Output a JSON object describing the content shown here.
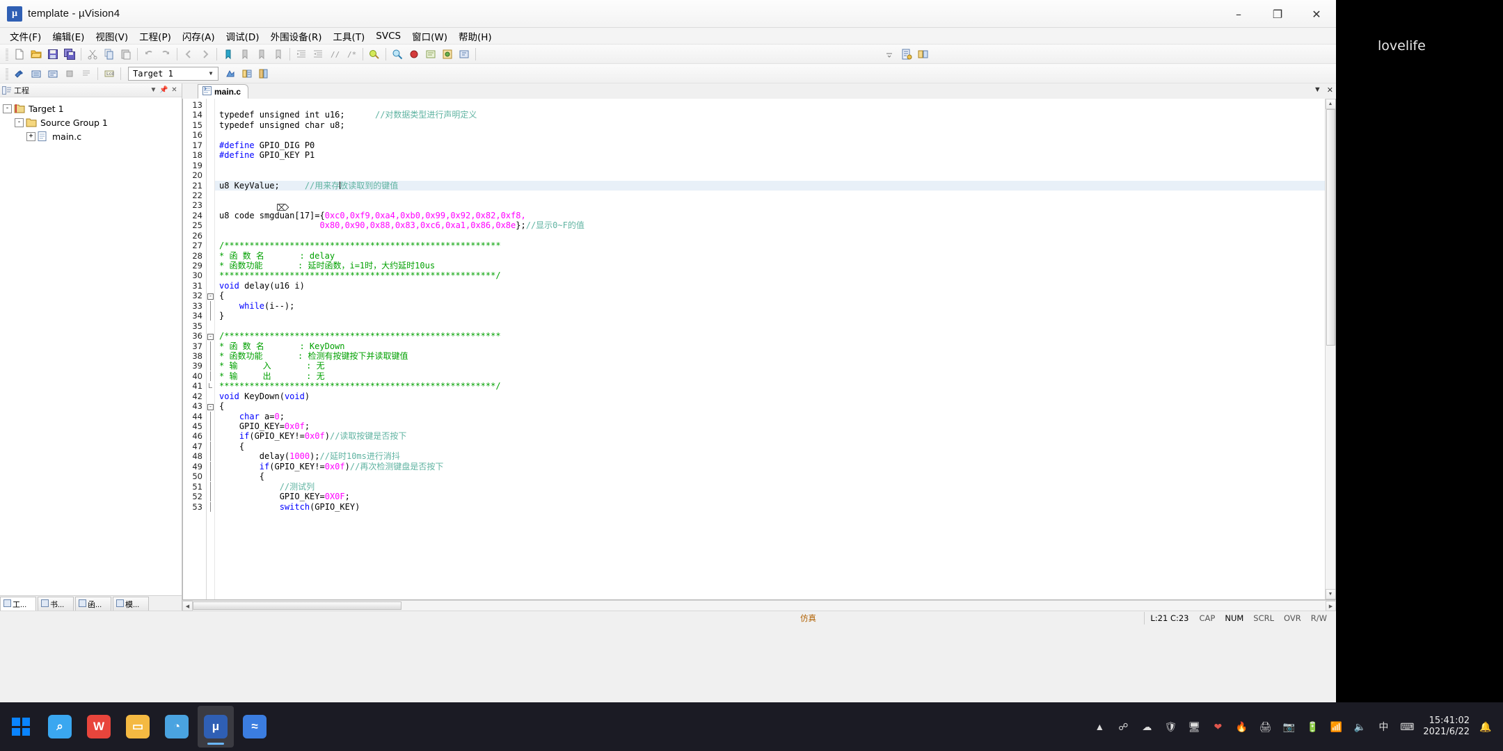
{
  "window": {
    "title": "template  - µVision4",
    "app_icon": "keil-uvision-icon",
    "minimize": "–",
    "maximize": "❐",
    "close": "✕"
  },
  "watermark": "lovelife",
  "menu": [
    {
      "label": "文件(F)",
      "name": "menu-file"
    },
    {
      "label": "编辑(E)",
      "name": "menu-edit"
    },
    {
      "label": "视图(V)",
      "name": "menu-view"
    },
    {
      "label": "工程(P)",
      "name": "menu-project"
    },
    {
      "label": "闪存(A)",
      "name": "menu-flash"
    },
    {
      "label": "调试(D)",
      "name": "menu-debug"
    },
    {
      "label": "外围设备(R)",
      "name": "menu-peripherals"
    },
    {
      "label": "工具(T)",
      "name": "menu-tools"
    },
    {
      "label": "SVCS",
      "name": "menu-svcs"
    },
    {
      "label": "窗口(W)",
      "name": "menu-window"
    },
    {
      "label": "帮助(H)",
      "name": "menu-help"
    }
  ],
  "toolbar_main": {
    "icons": [
      "new-file-icon",
      "open-folder-icon",
      "save-icon",
      "save-all-icon",
      "cut-icon",
      "copy-icon",
      "paste-icon",
      "undo-icon",
      "redo-icon",
      "navigate-back-icon",
      "navigate-forward-icon",
      "bookmark-toggle-icon",
      "bookmark-next-icon",
      "bookmark-prev-icon",
      "bookmark-clear-icon",
      "indent-icon",
      "outdent-icon",
      "comment-icon",
      "uncomment-icon",
      "debug-start-icon",
      "find-icon",
      "breakpoint-icon",
      "insert-bookmark-icon",
      "config-wizard-icon",
      "build-target-icon",
      "options-target-icon"
    ],
    "zoom_label": ""
  },
  "toolbar_build": {
    "icons": [
      "build-icon",
      "rebuild-icon",
      "batch-build-icon",
      "stop-build-icon",
      "download-icon",
      "lcd-icon"
    ],
    "target_value": "Target 1",
    "target_dropdown_icon": "chevron-down-icon",
    "after_icons": [
      "target-options-icon",
      "manage-components-icon",
      "book-icon"
    ]
  },
  "project_pane": {
    "title": "工程",
    "head_icon": "project-window-icon",
    "buttons": [
      "pin-icon",
      "minimize-icon",
      "close-icon"
    ],
    "tree": [
      {
        "label": "Target 1",
        "depth": 0,
        "expander": "-",
        "icon": "target-icon",
        "name": "tree-item-target-1"
      },
      {
        "label": "Source Group 1",
        "depth": 1,
        "expander": "-",
        "icon": "folder-icon",
        "name": "tree-item-source-group-1"
      },
      {
        "label": "main.c",
        "depth": 2,
        "expander": "+",
        "icon": "c-file-icon",
        "name": "tree-item-main-c"
      }
    ],
    "tabs": [
      {
        "label": "工...",
        "icon": "project-icon",
        "active": true,
        "name": "pane-tab-project"
      },
      {
        "label": "书...",
        "icon": "books-icon",
        "active": false,
        "name": "pane-tab-books"
      },
      {
        "label": "函...",
        "icon": "functions-icon",
        "active": false,
        "name": "pane-tab-functions"
      },
      {
        "label": "模...",
        "icon": "templates-icon",
        "active": false,
        "name": "pane-tab-templates"
      }
    ]
  },
  "editor": {
    "tab": {
      "label": "main.c",
      "icon": "c-file-icon"
    },
    "tabrow_buttons": [
      "chevron-down-icon",
      "close-icon"
    ],
    "first_line_number": 13,
    "cursor_line": 21,
    "lines": [
      {
        "n": 13,
        "fold": "",
        "hl": false,
        "tokens": []
      },
      {
        "n": 14,
        "fold": "",
        "hl": false,
        "tokens": [
          {
            "t": "typedef unsigned int u16;",
            "c": "plain"
          },
          {
            "t": "      ",
            "c": "plain"
          },
          {
            "t": "//对数据类型进行声明定义",
            "c": "cmt"
          }
        ]
      },
      {
        "n": 15,
        "fold": "",
        "hl": false,
        "tokens": [
          {
            "t": "typedef unsigned char u8;",
            "c": "plain"
          }
        ]
      },
      {
        "n": 16,
        "fold": "",
        "hl": false,
        "tokens": []
      },
      {
        "n": 17,
        "fold": "",
        "hl": false,
        "tokens": [
          {
            "t": "#define",
            "c": "pp"
          },
          {
            "t": " GPIO_DIG P0",
            "c": "plain"
          }
        ]
      },
      {
        "n": 18,
        "fold": "",
        "hl": false,
        "tokens": [
          {
            "t": "#define",
            "c": "pp"
          },
          {
            "t": " GPIO_KEY P1",
            "c": "plain"
          }
        ]
      },
      {
        "n": 19,
        "fold": "",
        "hl": false,
        "tokens": []
      },
      {
        "n": 20,
        "fold": "",
        "hl": false,
        "tokens": []
      },
      {
        "n": 21,
        "fold": "",
        "hl": true,
        "tokens": [
          {
            "t": "u8 KeyValue;",
            "c": "plain"
          },
          {
            "t": "     ",
            "c": "plain"
          },
          {
            "t": "//用来存放读取到的键值",
            "c": "cmt"
          }
        ]
      },
      {
        "n": 22,
        "fold": "",
        "hl": false,
        "tokens": []
      },
      {
        "n": 23,
        "fold": "",
        "hl": false,
        "tokens": []
      },
      {
        "n": 24,
        "fold": "",
        "hl": false,
        "tokens": [
          {
            "t": "u8 code smgduan[17]={",
            "c": "plain"
          },
          {
            "t": "0xc0,0xf9,0xa4,0xb0,0x99,0x92,0x82,0xf8,",
            "c": "num"
          }
        ]
      },
      {
        "n": 25,
        "fold": "",
        "hl": false,
        "tokens": [
          {
            "t": "                    ",
            "c": "plain"
          },
          {
            "t": "0x80,0x90,0x88,0x83,0xc6,0xa1,0x86,0x8e",
            "c": "num"
          },
          {
            "t": "};",
            "c": "plain"
          },
          {
            "t": "//显示0~F的值",
            "c": "cmt"
          }
        ]
      },
      {
        "n": 26,
        "fold": "",
        "hl": false,
        "tokens": []
      },
      {
        "n": 27,
        "fold": "",
        "hl": false,
        "tokens": [
          {
            "t": "/*******************************************************",
            "c": "green"
          }
        ]
      },
      {
        "n": 28,
        "fold": "",
        "hl": false,
        "tokens": [
          {
            "t": "* 函 数 名       : delay",
            "c": "green"
          }
        ]
      },
      {
        "n": 29,
        "fold": "",
        "hl": false,
        "tokens": [
          {
            "t": "* 函数功能       : 延时函数，i=1时，大约延时10us",
            "c": "green"
          }
        ]
      },
      {
        "n": 30,
        "fold": "",
        "hl": false,
        "tokens": [
          {
            "t": "*******************************************************/",
            "c": "green"
          }
        ]
      },
      {
        "n": 31,
        "fold": "",
        "hl": false,
        "tokens": [
          {
            "t": "void",
            "c": "kw"
          },
          {
            "t": " delay(u16 i)",
            "c": "plain"
          }
        ]
      },
      {
        "n": 32,
        "fold": "-",
        "hl": false,
        "tokens": [
          {
            "t": "{",
            "c": "plain"
          }
        ]
      },
      {
        "n": 33,
        "fold": "|",
        "hl": false,
        "tokens": [
          {
            "t": "    ",
            "c": "plain"
          },
          {
            "t": "while",
            "c": "kw"
          },
          {
            "t": "(i--);",
            "c": "plain"
          }
        ]
      },
      {
        "n": 34,
        "fold": "|",
        "hl": false,
        "tokens": [
          {
            "t": "}",
            "c": "plain"
          }
        ]
      },
      {
        "n": 35,
        "fold": "",
        "hl": false,
        "tokens": []
      },
      {
        "n": 36,
        "fold": "-",
        "hl": false,
        "tokens": [
          {
            "t": "/*******************************************************",
            "c": "green"
          }
        ]
      },
      {
        "n": 37,
        "fold": "|",
        "hl": false,
        "tokens": [
          {
            "t": "* 函 数 名       : KeyDown",
            "c": "green"
          }
        ]
      },
      {
        "n": 38,
        "fold": "|",
        "hl": false,
        "tokens": [
          {
            "t": "* 函数功能       : 检测有按键按下并读取键值",
            "c": "green"
          }
        ]
      },
      {
        "n": 39,
        "fold": "|",
        "hl": false,
        "tokens": [
          {
            "t": "* 输     入       : 无",
            "c": "green"
          }
        ]
      },
      {
        "n": 40,
        "fold": "|",
        "hl": false,
        "tokens": [
          {
            "t": "* 输     出       : 无",
            "c": "green"
          }
        ]
      },
      {
        "n": 41,
        "fold": "L",
        "hl": false,
        "tokens": [
          {
            "t": "*******************************************************/",
            "c": "green"
          }
        ]
      },
      {
        "n": 42,
        "fold": "",
        "hl": false,
        "tokens": [
          {
            "t": "void",
            "c": "kw"
          },
          {
            "t": " KeyDown(",
            "c": "plain"
          },
          {
            "t": "void",
            "c": "kw"
          },
          {
            "t": ")",
            "c": "plain"
          }
        ]
      },
      {
        "n": 43,
        "fold": "-",
        "hl": false,
        "tokens": [
          {
            "t": "{",
            "c": "plain"
          }
        ]
      },
      {
        "n": 44,
        "fold": "|",
        "hl": false,
        "tokens": [
          {
            "t": "    ",
            "c": "plain"
          },
          {
            "t": "char",
            "c": "kw"
          },
          {
            "t": " a=",
            "c": "plain"
          },
          {
            "t": "0",
            "c": "num"
          },
          {
            "t": ";",
            "c": "plain"
          }
        ]
      },
      {
        "n": 45,
        "fold": "|",
        "hl": false,
        "tokens": [
          {
            "t": "    GPIO_KEY=",
            "c": "plain"
          },
          {
            "t": "0x0f",
            "c": "num"
          },
          {
            "t": ";",
            "c": "plain"
          }
        ]
      },
      {
        "n": 46,
        "fold": "|",
        "hl": false,
        "tokens": [
          {
            "t": "    ",
            "c": "plain"
          },
          {
            "t": "if",
            "c": "kw"
          },
          {
            "t": "(GPIO_KEY!=",
            "c": "plain"
          },
          {
            "t": "0x0f",
            "c": "num"
          },
          {
            "t": ")",
            "c": "plain"
          },
          {
            "t": "//读取按键是否按下",
            "c": "cmt"
          }
        ]
      },
      {
        "n": 47,
        "fold": "|",
        "hl": false,
        "tokens": [
          {
            "t": "    {",
            "c": "plain"
          }
        ]
      },
      {
        "n": 48,
        "fold": "|",
        "hl": false,
        "tokens": [
          {
            "t": "        delay(",
            "c": "plain"
          },
          {
            "t": "1000",
            "c": "num"
          },
          {
            "t": ");",
            "c": "plain"
          },
          {
            "t": "//延时10ms进行消抖",
            "c": "cmt"
          }
        ]
      },
      {
        "n": 49,
        "fold": "|",
        "hl": false,
        "tokens": [
          {
            "t": "        ",
            "c": "plain"
          },
          {
            "t": "if",
            "c": "kw"
          },
          {
            "t": "(GPIO_KEY!=",
            "c": "plain"
          },
          {
            "t": "0x0f",
            "c": "num"
          },
          {
            "t": ")",
            "c": "plain"
          },
          {
            "t": "//再次检测键盘是否按下",
            "c": "cmt"
          }
        ]
      },
      {
        "n": 50,
        "fold": "|",
        "hl": false,
        "tokens": [
          {
            "t": "        {",
            "c": "plain"
          }
        ]
      },
      {
        "n": 51,
        "fold": "|",
        "hl": false,
        "tokens": [
          {
            "t": "            ",
            "c": "plain"
          },
          {
            "t": "//测试列",
            "c": "cmt"
          }
        ]
      },
      {
        "n": 52,
        "fold": "|",
        "hl": false,
        "tokens": [
          {
            "t": "            GPIO_KEY=",
            "c": "plain"
          },
          {
            "t": "0X0F",
            "c": "num"
          },
          {
            "t": ";",
            "c": "plain"
          }
        ]
      },
      {
        "n": 53,
        "fold": "|",
        "hl": false,
        "tokens": [
          {
            "t": "            ",
            "c": "plain"
          },
          {
            "t": "switch",
            "c": "kw"
          },
          {
            "t": "(GPIO_KEY)",
            "c": "plain"
          }
        ]
      }
    ]
  },
  "statusbar": {
    "simulation": "仿真",
    "position": "L:21 C:23",
    "flags": [
      {
        "label": "CAP",
        "on": false
      },
      {
        "label": "NUM",
        "on": true
      },
      {
        "label": "SCRL",
        "on": false
      },
      {
        "label": "OVR",
        "on": false
      },
      {
        "label": "R/W",
        "on": false
      }
    ]
  },
  "taskbar": {
    "start_icon": "windows-start-icon",
    "apps": [
      {
        "name": "taskbar-search",
        "icon": "search-icon",
        "letter": "⌕",
        "color": "#3aa7f0",
        "active": false
      },
      {
        "name": "taskbar-wps",
        "icon": "wps-icon",
        "letter": "W",
        "color": "#e8453c",
        "active": false
      },
      {
        "name": "taskbar-explorer",
        "icon": "file-explorer-icon",
        "letter": "▭",
        "color": "#f4b942",
        "active": false
      },
      {
        "name": "taskbar-qq",
        "icon": "qq-icon",
        "letter": "◔",
        "color": "#4aa3e0",
        "active": false
      },
      {
        "name": "taskbar-keil",
        "icon": "keil-uvision-icon",
        "letter": "μ",
        "color": "#2f5fb4",
        "active": true
      },
      {
        "name": "taskbar-editor",
        "icon": "editor-icon",
        "letter": "≈",
        "color": "#3b7de0",
        "active": false
      }
    ],
    "tray_icons": [
      "chevron-up-icon",
      "bluetooth-icon",
      "cloud-icon",
      "shield-icon",
      "monitor-icon",
      "heart-icon",
      "flame-icon",
      "printer-icon",
      "camera-icon",
      "battery-icon",
      "network-icon",
      "volume-icon",
      "keyboard-icon"
    ],
    "ime": "中",
    "notification_icon": "notification-bell-icon",
    "time": "15:41:02",
    "date": "2021/6/22"
  }
}
